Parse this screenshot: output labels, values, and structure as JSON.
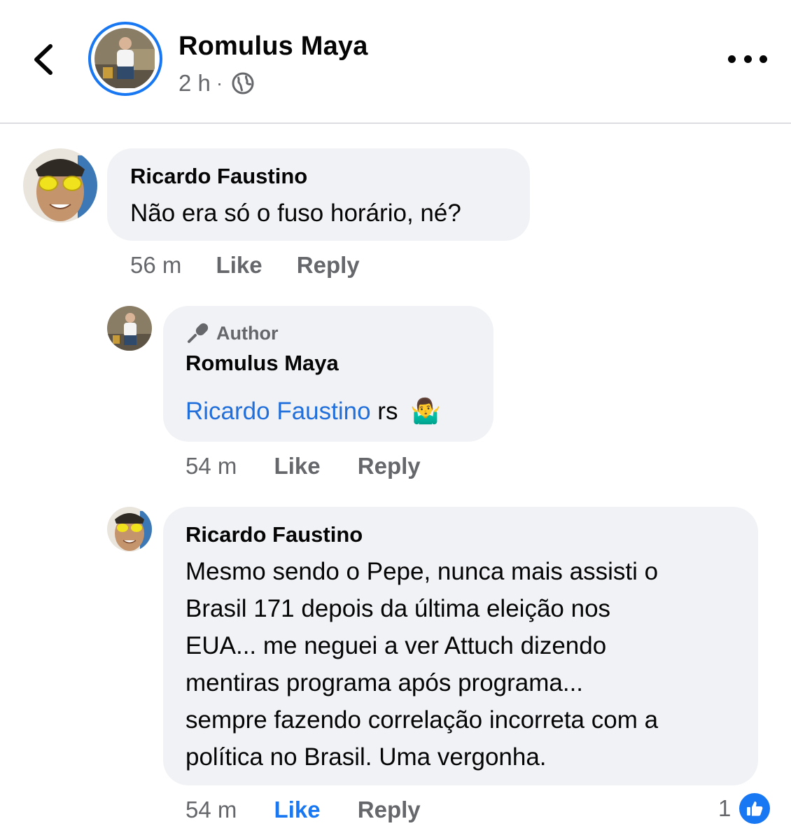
{
  "header": {
    "name": "Romulus Maya",
    "time": "2 h",
    "separator": "·"
  },
  "comments": [
    {
      "name": "Ricardo Faustino",
      "text": "Não era só o fuso horário, né?",
      "time": "56 m",
      "like": "Like",
      "reply": "Reply"
    },
    {
      "badge": "Author",
      "name": "Romulus Maya",
      "mention": "Ricardo Faustino",
      "text_suffix": " rs",
      "emoji": "🤷‍♂️",
      "time": "54 m",
      "like": "Like",
      "reply": "Reply"
    },
    {
      "name": "Ricardo Faustino",
      "lines": [
        "Mesmo sendo o Pepe, nunca mais assisti o",
        "Brasil 171 depois da última eleição nos",
        "EUA... me neguei a ver Attuch dizendo",
        "mentiras programa após programa...",
        "sempre fazendo correlação incorreta com a",
        "política no Brasil. Uma vergonha."
      ],
      "time": "54 m",
      "like": "Like",
      "reply": "Reply",
      "reaction_count": "1"
    }
  ],
  "colors": {
    "accent": "#1877f2",
    "bubble": "#f0f2f5",
    "meta": "#65676b"
  }
}
